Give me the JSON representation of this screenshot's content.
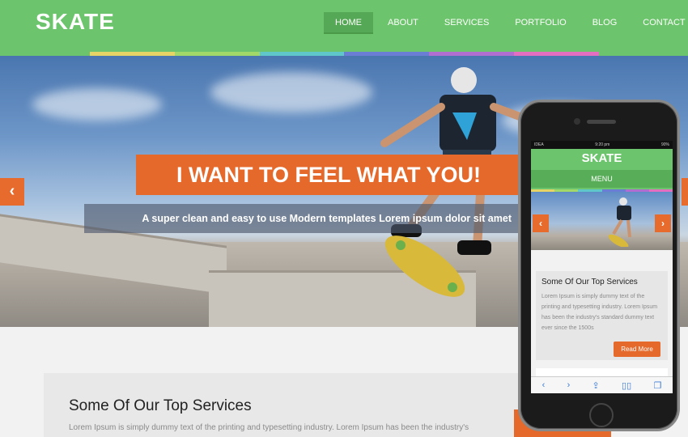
{
  "site": {
    "logo": "SKATE"
  },
  "nav": {
    "items": [
      {
        "label": "HOME",
        "active": true
      },
      {
        "label": "ABOUT",
        "active": false
      },
      {
        "label": "SERVICES",
        "active": false
      },
      {
        "label": "PORTFOLIO",
        "active": false
      },
      {
        "label": "BLOG",
        "active": false
      },
      {
        "label": "CONTACT",
        "active": false
      }
    ]
  },
  "colors": {
    "header_green": "#6cc46c",
    "accent_orange": "#e4692b",
    "colorbar": [
      "#e7d466",
      "#a2d86a",
      "#5fc7c9",
      "#6a7fd3",
      "#b06fd0",
      "#e46fc0"
    ]
  },
  "hero": {
    "headline": "I WANT TO FEEL WHAT YOU!",
    "subline": "A super clean and easy to use Modern templates Lorem ipsum dolor sit amet",
    "prev_icon": "chevron-left-icon",
    "next_icon": "chevron-right-icon"
  },
  "services": {
    "title": "Some Of Our Top Services",
    "text": "Lorem Ipsum is simply dummy text of the printing and typesetting industry. Lorem Ipsum has been the industry's"
  },
  "mobile": {
    "status": {
      "carrier": "IDEA",
      "time": "9:20 pm",
      "battery": "90%"
    },
    "logo": "SKATE",
    "menu_label": "MENU",
    "card_title": "Some Of Our Top Services",
    "card_text": "Lorem Ipsum is simply dummy text of the printing and typesetting industry. Lorem Ipsum has been the industry's standard dummy text ever since the 1500s",
    "read_more": "Read More",
    "toolbar_icons": [
      "back-icon",
      "forward-icon",
      "share-icon",
      "bookmarks-icon",
      "tabs-icon"
    ]
  }
}
